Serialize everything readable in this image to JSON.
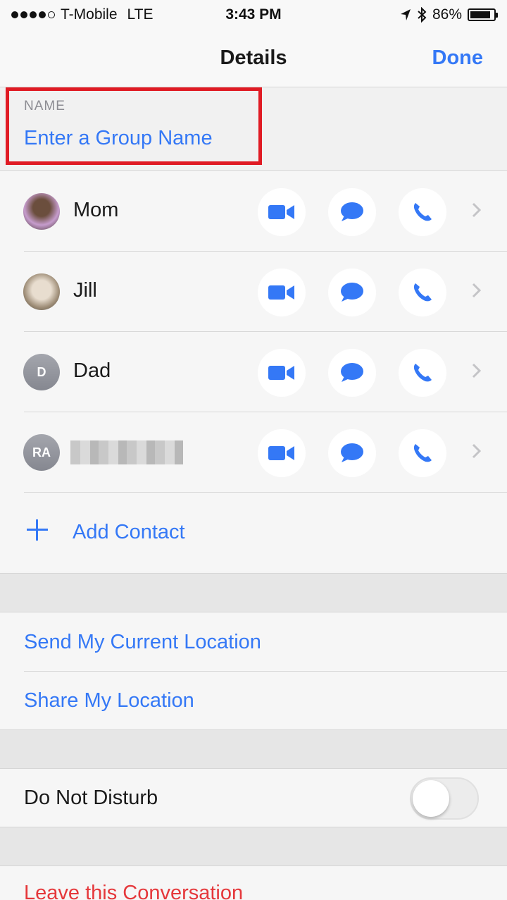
{
  "status_bar": {
    "carrier": "T-Mobile",
    "network": "LTE",
    "time": "3:43 PM",
    "battery_percent": "86%",
    "battery_level": 0.86,
    "icons": [
      "signal-dots",
      "location-arrow-icon",
      "bluetooth-icon",
      "battery-icon"
    ]
  },
  "nav": {
    "title": "Details",
    "done_label": "Done"
  },
  "name_field": {
    "label": "NAME",
    "placeholder": "Enter a Group Name",
    "value": "",
    "highlight_color": "#e01b24"
  },
  "contacts": [
    {
      "name": "Mom",
      "avatar": "photo",
      "initials": ""
    },
    {
      "name": "Jill",
      "avatar": "photo",
      "initials": ""
    },
    {
      "name": "Dad",
      "avatar": "initials",
      "initials": "D"
    },
    {
      "name": "",
      "avatar": "initials",
      "initials": "RA",
      "name_redacted": true
    }
  ],
  "contact_actions": [
    "video-camera-icon",
    "message-bubble-icon",
    "phone-icon",
    "chevron-right-icon"
  ],
  "add_contact": {
    "label": "Add Contact"
  },
  "location": {
    "send_current_label": "Send My Current Location",
    "share_label": "Share My Location"
  },
  "do_not_disturb": {
    "label": "Do Not Disturb",
    "enabled": false
  },
  "leave": {
    "label": "Leave this Conversation"
  },
  "colors": {
    "accent": "#3478f6",
    "destructive": "#e5383b"
  }
}
